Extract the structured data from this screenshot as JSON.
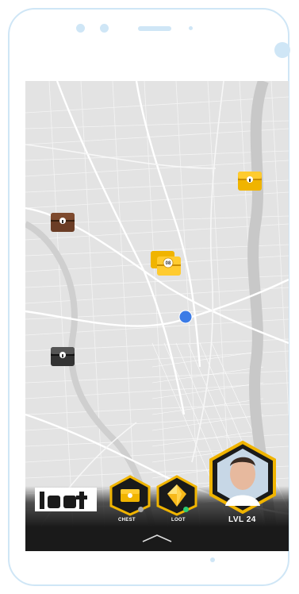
{
  "colors": {
    "frame": "#cfe6f6",
    "map_background": "#e3e3e3",
    "road": "#ffffff",
    "river": "#c8c8c8",
    "gold": "#f0b400",
    "bar": "#1a1a1a",
    "user_dot": "#3b7be6",
    "status_gray": "#aaaaaa",
    "status_green": "#2ecc71"
  },
  "brand": {
    "logo_text": "loot"
  },
  "map": {
    "user_location_icon": "location-dot-icon",
    "markers": [
      {
        "type": "gold-chest-icon"
      },
      {
        "type": "brown-chest-icon"
      },
      {
        "type": "gold-chest-cluster-icon",
        "label": "08"
      },
      {
        "type": "silver-chest-icon"
      }
    ]
  },
  "toolbar": {
    "chest_label": "CHEST",
    "loot_label": "LOOT",
    "level_label": "LVL 24"
  },
  "nav": {
    "home_indicator_icon": "chevron-up-icon"
  }
}
